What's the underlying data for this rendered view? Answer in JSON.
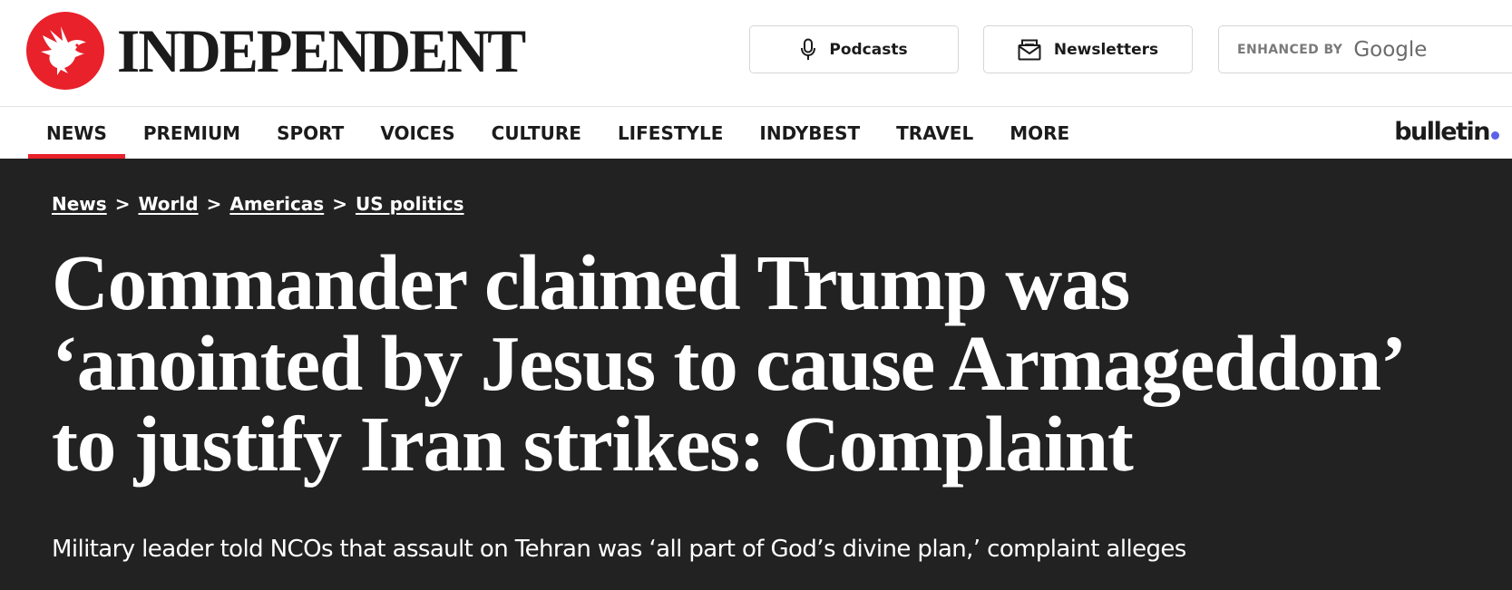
{
  "header": {
    "logo_text": "INDEPENDENT",
    "podcasts_label": "Podcasts",
    "newsletters_label": "Newsletters",
    "search_enhanced_label": "ENHANCED BY",
    "search_brand": "Google"
  },
  "nav": {
    "items": [
      {
        "label": "NEWS",
        "active": true
      },
      {
        "label": "PREMIUM"
      },
      {
        "label": "SPORT"
      },
      {
        "label": "VOICES"
      },
      {
        "label": "CULTURE"
      },
      {
        "label": "LIFESTYLE"
      },
      {
        "label": "INDYBEST"
      },
      {
        "label": "TRAVEL"
      },
      {
        "label": "MORE"
      }
    ],
    "bulletin_label": "bulletin"
  },
  "article": {
    "breadcrumbs": [
      "News",
      "World",
      "Americas",
      "US politics"
    ],
    "breadcrumb_separator": ">",
    "headline_lines": [
      "Commander claimed Trump was",
      "‘anointed by Jesus to cause Armageddon’",
      "to justify Iran strikes: Complaint"
    ],
    "standfirst": "Military leader told NCOs that assault on Tehran was ‘all part of God’s divine plan,’ complaint alleges"
  },
  "colors": {
    "brand_red": "#e8212a",
    "hero_background": "#222222",
    "bulletin_dot": "#5a63e8"
  },
  "icons": {
    "logo": "eagle-icon",
    "podcasts": "microphone-icon",
    "newsletters": "envelope-icon"
  }
}
